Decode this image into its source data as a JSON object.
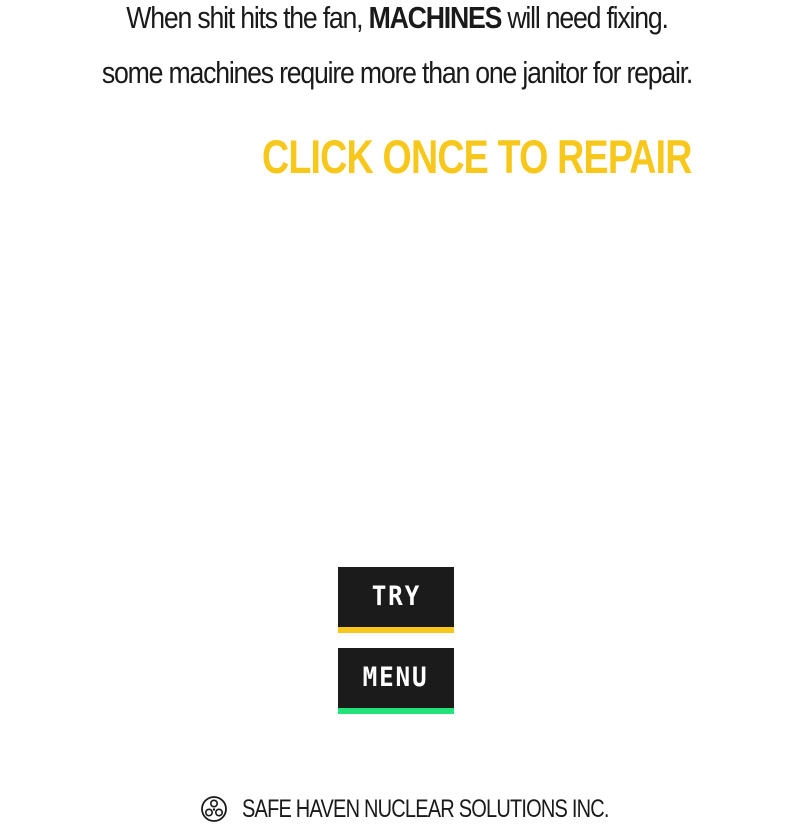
{
  "intro": {
    "line1_before": "When shit hits the fan, ",
    "line1_emphasis": "MACHINES",
    "line1_after": " will need fixing.",
    "line2": "some machines require more than one janitor for repair."
  },
  "instruction": {
    "label": "CLICK ONCE TO REPAIR",
    "color": "#f7c81b"
  },
  "buttons": {
    "try": {
      "label": "TRY",
      "accent_color": "#f7c81b"
    },
    "menu": {
      "label": "MENU",
      "accent_color": "#22e27a"
    }
  },
  "footer": {
    "icon": "radiation-logo-icon",
    "company": "SAFE HAVEN NUCLEAR SOLUTIONS INC."
  }
}
